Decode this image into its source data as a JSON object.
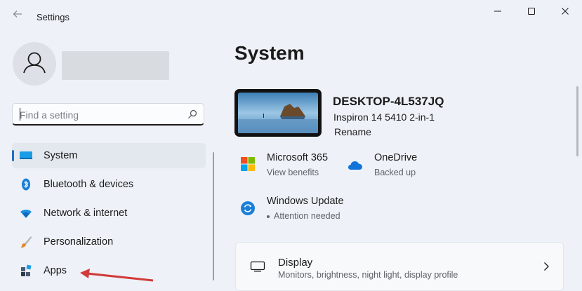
{
  "window": {
    "title": "Settings",
    "back_icon": "back-arrow-icon",
    "controls": [
      "minimize-icon",
      "maximize-icon",
      "close-icon"
    ]
  },
  "search": {
    "placeholder": "Find a setting"
  },
  "sidebar": {
    "items": [
      {
        "label": "System",
        "icon": "system-icon",
        "active": true
      },
      {
        "label": "Bluetooth & devices",
        "icon": "bluetooth-icon"
      },
      {
        "label": "Network & internet",
        "icon": "wifi-icon"
      },
      {
        "label": "Personalization",
        "icon": "brush-icon"
      },
      {
        "label": "Apps",
        "icon": "apps-icon"
      }
    ]
  },
  "main": {
    "title": "System",
    "device": {
      "name": "DESKTOP-4L537JQ",
      "model": "Inspiron 14 5410 2-in-1",
      "rename": "Rename"
    },
    "tiles": [
      {
        "title": "Microsoft 365",
        "subtitle": "View benefits",
        "icon": "microsoft-365-icon"
      },
      {
        "title": "OneDrive",
        "subtitle": "Backed up",
        "icon": "onedrive-icon"
      },
      {
        "title": "Windows Update",
        "subtitle": "Attention needed",
        "icon": "windows-update-icon"
      }
    ],
    "cards": [
      {
        "title": "Display",
        "subtitle": "Monitors, brightness, night light, display profile",
        "icon": "display-icon"
      }
    ]
  },
  "colors": {
    "accent": "#1f6fc4",
    "background": "#eef2f8",
    "annotation_arrow": "#d23b3b"
  }
}
